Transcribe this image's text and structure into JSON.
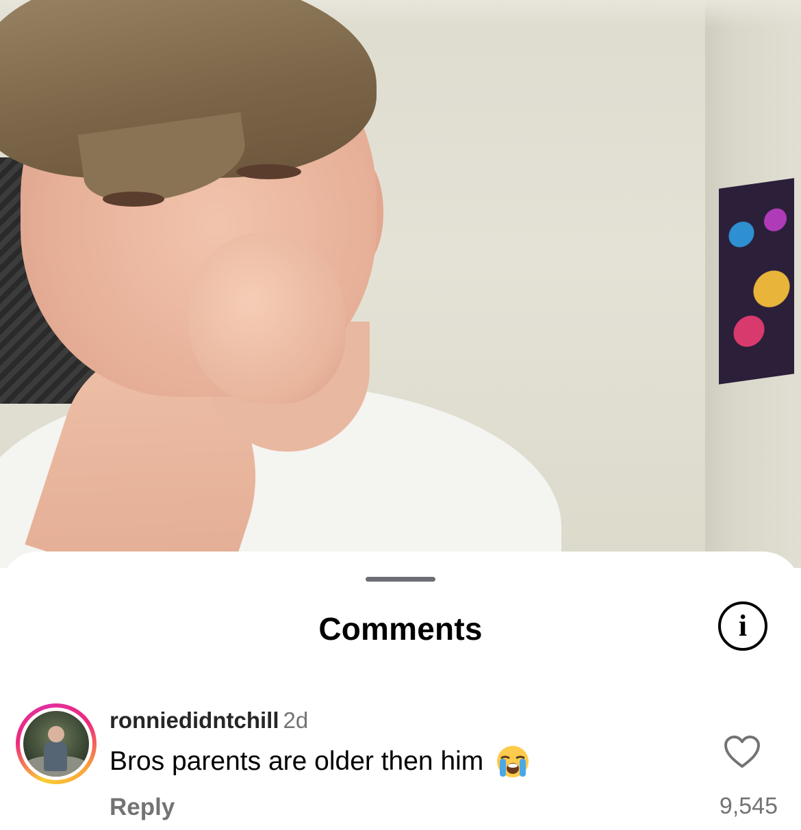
{
  "sheet": {
    "title": "Comments",
    "info_icon": "info-circle-icon"
  },
  "comment": {
    "username": "ronniedidntchill",
    "time": "2d",
    "text": "Bros parents are older then him",
    "emoji": "loudly-crying-face-emoji",
    "reply_label": "Reply",
    "like_icon": "heart-outline-icon",
    "like_count": "9,545"
  },
  "colors": {
    "secondary_text": "#737373",
    "story_ring_start": "#f9ce34",
    "story_ring_end": "#ee2a7b"
  }
}
